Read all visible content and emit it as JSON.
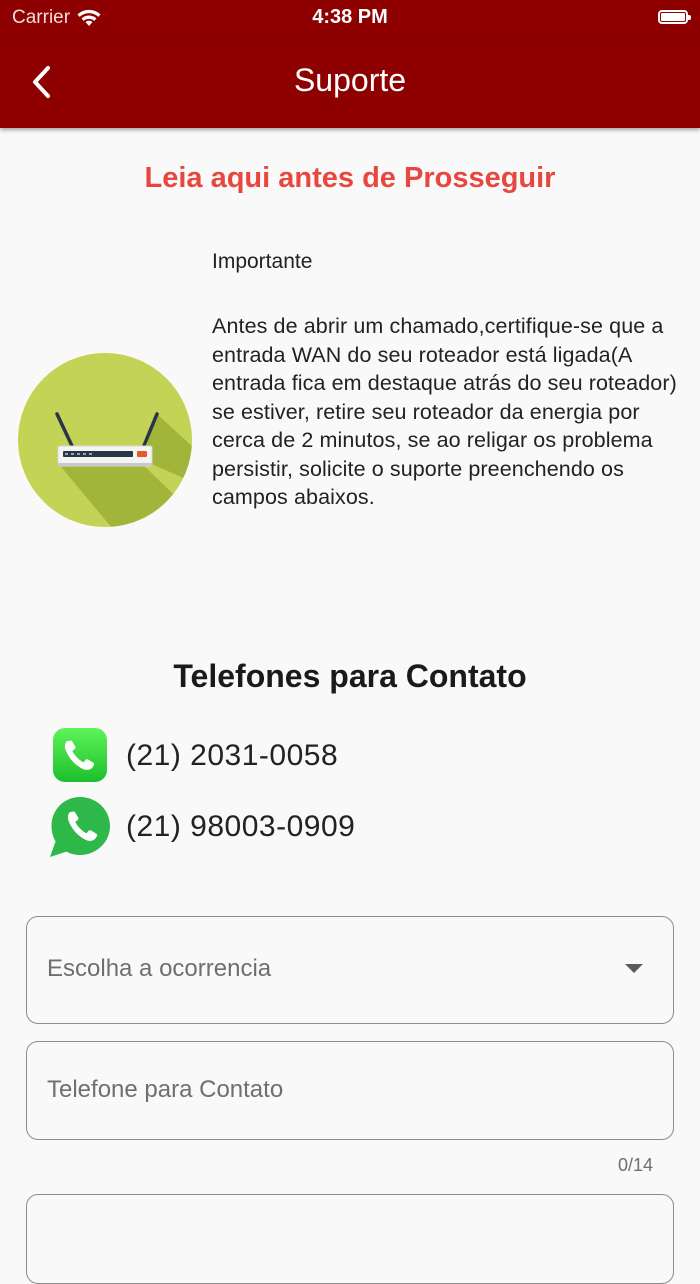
{
  "status_bar": {
    "carrier": "Carrier",
    "time": "4:38 PM"
  },
  "app_bar": {
    "title": "Suporte"
  },
  "notice": {
    "title": "Leia aqui antes de Prosseguir",
    "label": "Importante",
    "text": "Antes de abrir um chamado,certifique-se que a entrada WAN do seu roteador está ligada(A entrada fica em destaque atrás do seu roteador) se estiver, retire seu roteador da energia por cerca de 2 minutos, se ao religar os problema persistir, solicite o suporte preenchendo os campos abaixos."
  },
  "contacts": {
    "title": "Telefones para Contato",
    "items": [
      {
        "icon": "phone-icon",
        "number": "(21) 2031-0058"
      },
      {
        "icon": "whatsapp-icon",
        "number": "(21) 98003-0909"
      }
    ]
  },
  "form": {
    "occurrence_placeholder": "Escolha a ocorrencia",
    "phone_placeholder": "Telefone para Contato",
    "phone_counter": "0/14"
  },
  "colors": {
    "primary": "#8e0000",
    "notice_title": "#e8473f",
    "router_circle": "#c3d356"
  }
}
